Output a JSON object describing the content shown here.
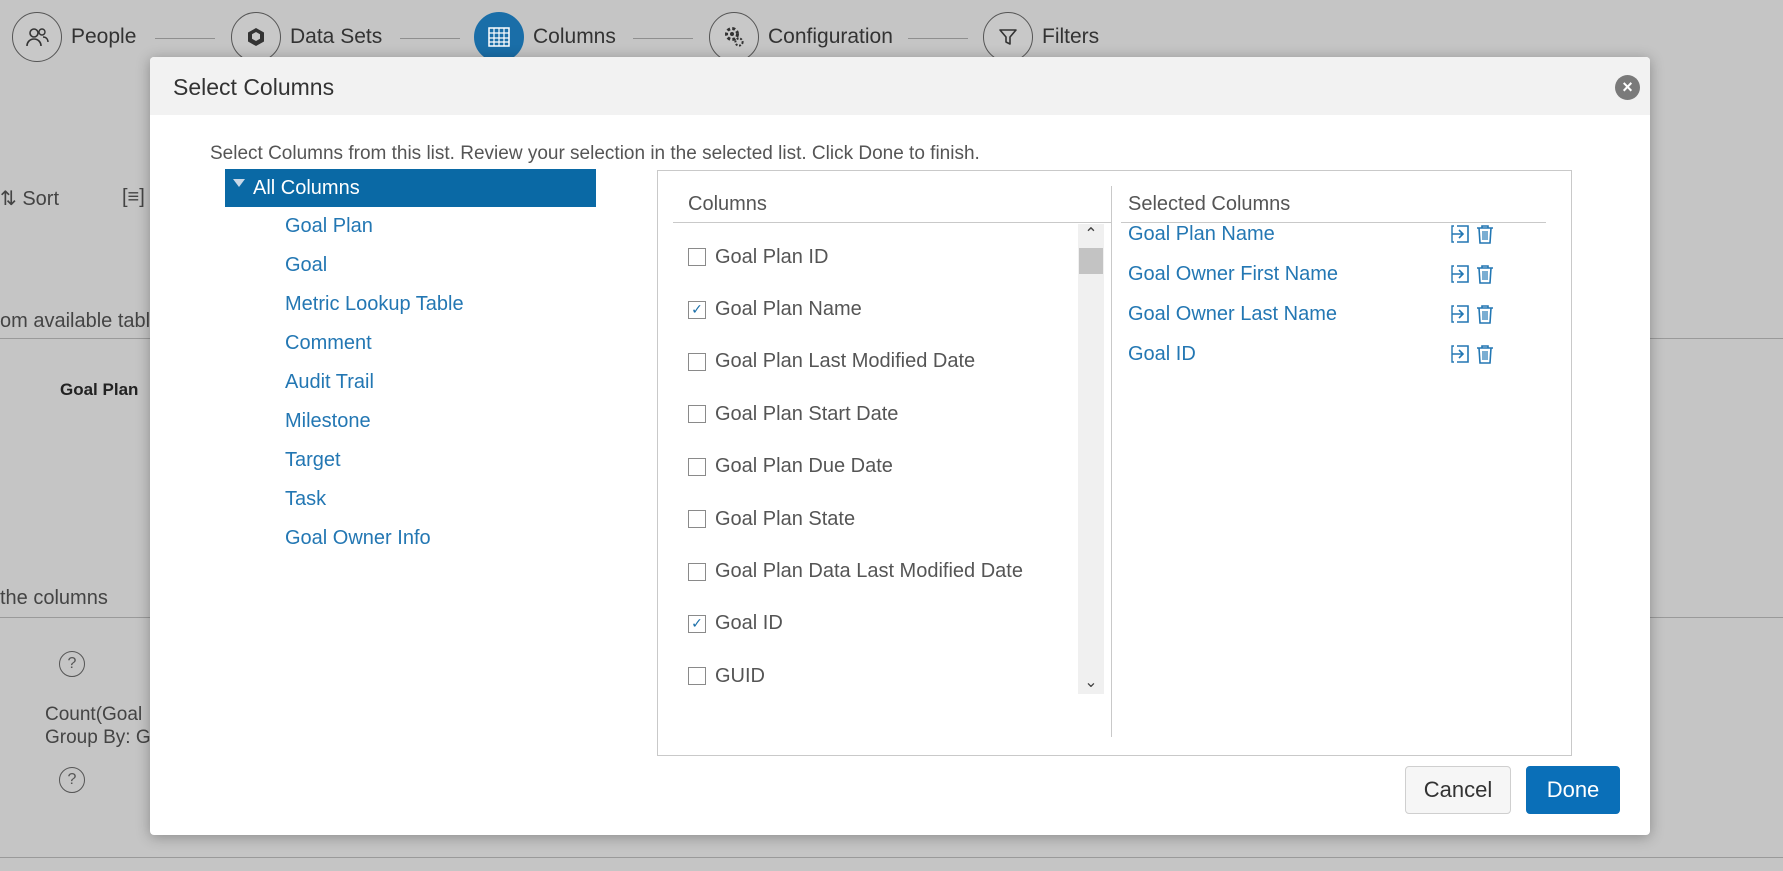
{
  "wizard": {
    "steps": [
      {
        "label": "People",
        "icon": "people-icon",
        "active": false
      },
      {
        "label": "Data Sets",
        "icon": "dataset-icon",
        "active": false
      },
      {
        "label": "Columns",
        "icon": "table-icon",
        "active": true
      },
      {
        "label": "Configuration",
        "icon": "gear-icon",
        "active": false
      },
      {
        "label": "Filters",
        "icon": "filter-icon",
        "active": false
      }
    ]
  },
  "background": {
    "sort_label": "Sort",
    "list_icon": "[≡]",
    "tables_text": "om available table",
    "goal_plan_text": "Goal Plan",
    "columns_text": "the columns",
    "count_text": "Count(Goal",
    "group_by_text": "Group By: G",
    "help_glyph": "?"
  },
  "modal": {
    "title": "Select Columns",
    "close_glyph": "×",
    "instructions": "Select Columns from this list. Review your selection in the selected list. Click Done to finish.",
    "tree": {
      "root": "All Columns",
      "items": [
        "Goal Plan",
        "Goal",
        "Metric Lookup Table",
        "Comment",
        "Audit Trail",
        "Milestone",
        "Target",
        "Task",
        "Goal Owner Info"
      ]
    },
    "columns_header": "Columns",
    "columns": [
      {
        "label": "Goal Plan ID",
        "checked": false
      },
      {
        "label": "Goal Plan Name",
        "checked": true
      },
      {
        "label": "Goal Plan Last Modified Date",
        "checked": false
      },
      {
        "label": "Goal Plan Start Date",
        "checked": false
      },
      {
        "label": "Goal Plan Due Date",
        "checked": false
      },
      {
        "label": "Goal Plan State",
        "checked": false
      },
      {
        "label": "Goal Plan Data Last Modified Date",
        "checked": false
      },
      {
        "label": "Goal ID",
        "checked": true
      },
      {
        "label": "GUID",
        "checked": false
      }
    ],
    "selected_header": "Selected Columns",
    "selected": [
      "Goal Plan Name",
      "Goal Owner First Name",
      "Goal Owner Last Name",
      "Goal ID"
    ],
    "cancel_label": "Cancel",
    "done_label": "Done",
    "colors": {
      "accent": "#0a69a5",
      "link": "#2377b3"
    }
  }
}
